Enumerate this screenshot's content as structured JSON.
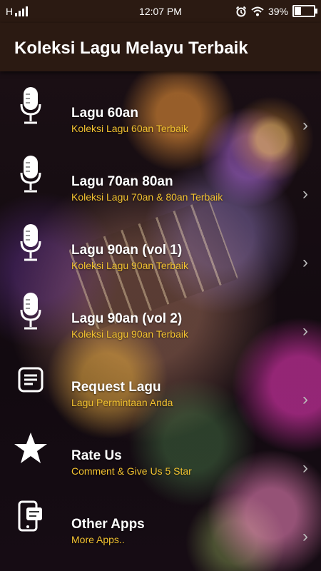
{
  "status_bar": {
    "carrier": "H",
    "time": "12:07 PM",
    "battery": "39%",
    "battery_level": 0.39
  },
  "app_bar": {
    "title": "Koleksi Lagu Melayu Terbaik"
  },
  "menu": {
    "items": [
      {
        "title": "Lagu 60an",
        "subtitle": "Koleksi Lagu 60an Terbaik",
        "icon": "microphone-icon"
      },
      {
        "title": "Lagu 70an 80an",
        "subtitle": "Koleksi Lagu 70an & 80an Terbaik",
        "icon": "microphone-icon"
      },
      {
        "title": "Lagu 90an (vol 1)",
        "subtitle": "Koleksi Lagu 90an Terbaik",
        "icon": "microphone-icon"
      },
      {
        "title": "Lagu 90an (vol 2)",
        "subtitle": "Koleksi Lagu 90an Terbaik",
        "icon": "microphone-icon"
      },
      {
        "title": "Request Lagu",
        "subtitle": "Lagu Permintaan Anda",
        "icon": "note-icon"
      },
      {
        "title": "Rate Us",
        "subtitle": "Comment & Give Us 5 Star",
        "icon": "star-icon"
      },
      {
        "title": "Other Apps",
        "subtitle": "More Apps..",
        "icon": "phone-apps-icon"
      }
    ]
  },
  "colors": {
    "app_bar": "#2b1a12",
    "subtitle": "#f2c230"
  }
}
